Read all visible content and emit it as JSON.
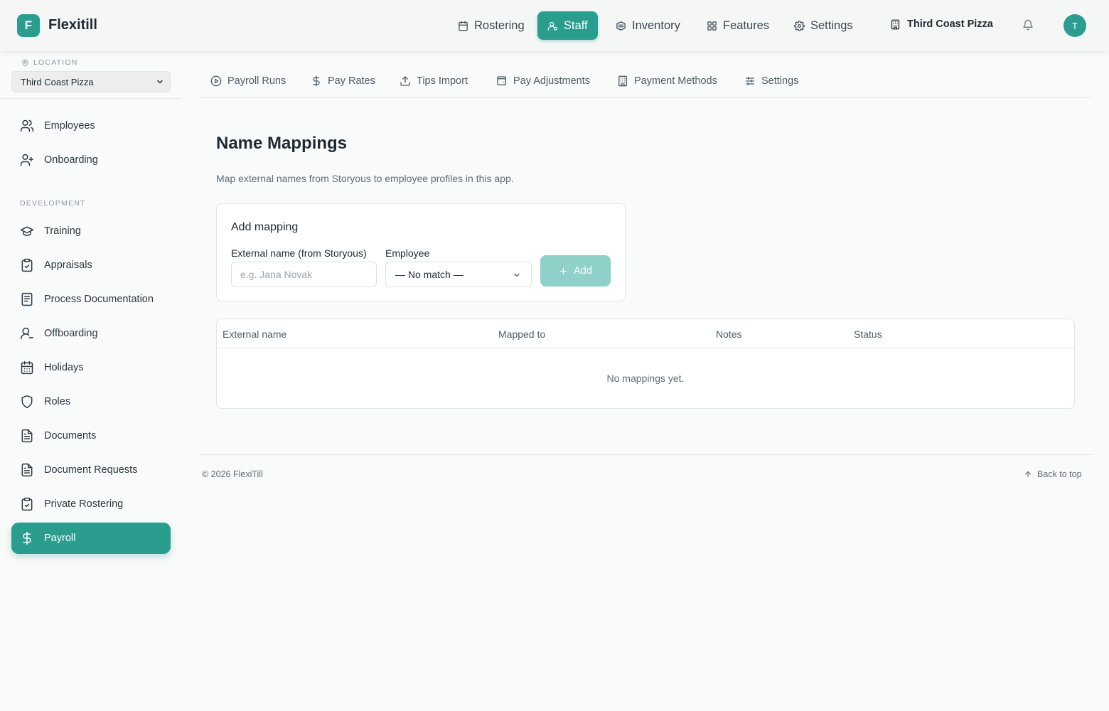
{
  "app": {
    "logo_letter": "F",
    "name": "Flexitill"
  },
  "topnav": {
    "items": [
      {
        "label": "Rostering",
        "icon": "calendar-icon"
      },
      {
        "label": "Staff",
        "icon": "users-icon",
        "active": true
      },
      {
        "label": "Inventory",
        "icon": "box-icon"
      },
      {
        "label": "Features",
        "icon": "grid-icon"
      },
      {
        "label": "Settings",
        "icon": "gear-icon"
      }
    ],
    "location": "Third Coast Pizza",
    "avatar": "T"
  },
  "sidebar": {
    "location_label": "LOCATION",
    "location_value": "Third Coast Pizza",
    "items_top": [
      {
        "label": "Employees",
        "icon": "users-icon"
      },
      {
        "label": "Onboarding",
        "icon": "user-plus-icon"
      }
    ],
    "section_label": "DEVELOPMENT",
    "items_dev": [
      {
        "label": "Training",
        "icon": "graduation-cap-icon"
      },
      {
        "label": "Appraisals",
        "icon": "clipboard-check-icon"
      },
      {
        "label": "Process Documentation",
        "icon": "book-icon"
      },
      {
        "label": "Offboarding",
        "icon": "user-minus-icon"
      },
      {
        "label": "Holidays",
        "icon": "calendar-days-icon"
      },
      {
        "label": "Roles",
        "icon": "shield-icon"
      },
      {
        "label": "Documents",
        "icon": "file-text-icon"
      },
      {
        "label": "Document Requests",
        "icon": "file-text-icon"
      },
      {
        "label": "Private Rostering",
        "icon": "clipboard-check-icon"
      },
      {
        "label": "Payroll",
        "icon": "dollar-icon",
        "active": true
      }
    ]
  },
  "tabs": [
    {
      "label": "Payroll Runs",
      "icon": "play-circle-icon"
    },
    {
      "label": "Pay Rates",
      "icon": "dollar-icon"
    },
    {
      "label": "Tips Import",
      "icon": "upload-icon"
    },
    {
      "label": "Pay Adjustments",
      "icon": "wallet-icon"
    },
    {
      "label": "Payment Methods",
      "icon": "building-icon"
    },
    {
      "label": "Settings",
      "icon": "sliders-icon"
    }
  ],
  "page": {
    "title": "Name Mappings",
    "description": "Map external names from Storyous to employee profiles in this app."
  },
  "add_mapping": {
    "title": "Add mapping",
    "external_label": "External name (from Storyous)",
    "external_placeholder": "e.g. Jana Novak",
    "external_value": "",
    "employee_label": "Employee",
    "employee_selected": "— No match —",
    "add_label": "Add"
  },
  "table": {
    "columns": [
      "External name",
      "Mapped to",
      "Notes",
      "Status"
    ],
    "rows": [],
    "empty_text": "No mappings yet."
  },
  "footer": {
    "copyright": "© 2026 FlexiTill",
    "back_to_top": "Back to top"
  },
  "colors": {
    "accent": "#2a9d8f",
    "accent_disabled": "#8fd0c8",
    "background": "#f9fafa"
  }
}
